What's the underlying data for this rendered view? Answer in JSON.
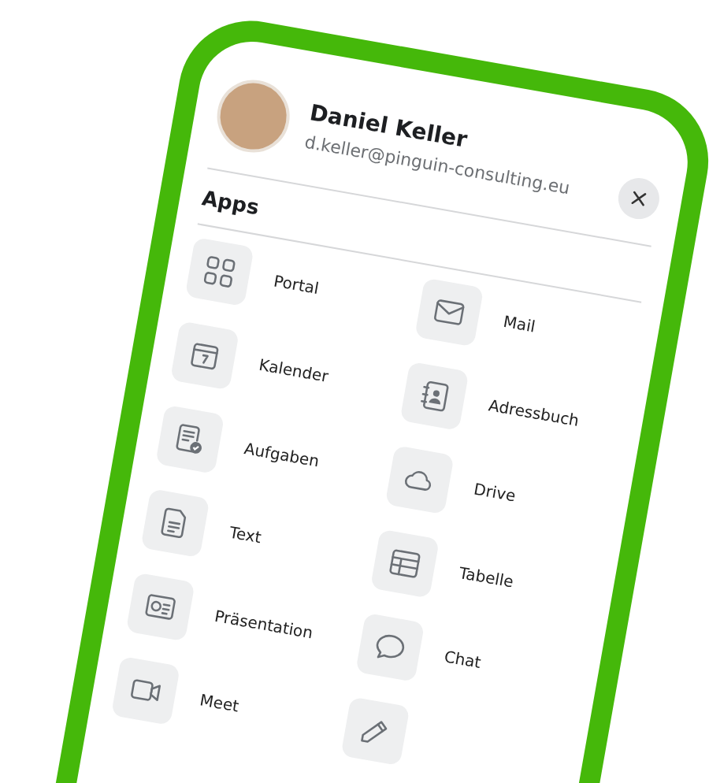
{
  "profile": {
    "name": "Daniel Keller",
    "email": "d.keller@pinguin-consulting.eu"
  },
  "section_title": "Apps",
  "apps": [
    {
      "label": "Portal"
    },
    {
      "label": "Mail"
    },
    {
      "label": "Kalender"
    },
    {
      "label": "Adressbuch"
    },
    {
      "label": "Aufgaben"
    },
    {
      "label": "Drive"
    },
    {
      "label": "Text"
    },
    {
      "label": "Tabelle"
    },
    {
      "label": "Präsentation"
    },
    {
      "label": "Chat"
    },
    {
      "label": "Meet"
    }
  ]
}
